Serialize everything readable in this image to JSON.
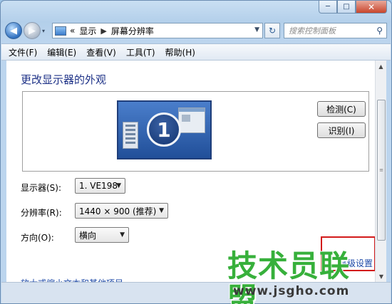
{
  "window": {
    "caption_minimize": "─",
    "caption_maximize": "□",
    "caption_close": "✕"
  },
  "nav": {
    "back_glyph": "◀",
    "forward_glyph": "▶",
    "history_glyph": "▾"
  },
  "address": {
    "chevron": "«",
    "crumb1": "显示",
    "separator": "▶",
    "crumb2": "屏幕分辨率",
    "dropdown_glyph": "▼",
    "icon": "control-panel-icon"
  },
  "refresh": {
    "glyph": "↻"
  },
  "search": {
    "placeholder": "搜索控制面板",
    "icon_glyph": "⚲"
  },
  "menu": [
    "文件(F)",
    "编辑(E)",
    "查看(V)",
    "工具(T)",
    "帮助(H)"
  ],
  "page": {
    "title": "更改显示器的外观",
    "monitor_number": "1"
  },
  "buttons": {
    "detect": "检测(C)",
    "identify": "识别(I)"
  },
  "form": {
    "display_label": "显示器(S):",
    "display_value": "1. VE198",
    "resolution_label": "分辨率(R):",
    "resolution_value": "1440 × 900 (推荐)",
    "orientation_label": "方向(O):",
    "orientation_value": "横向",
    "combo_arrow": "▼"
  },
  "links": {
    "advanced": "高级设置",
    "text_size_partial": "放大或缩小文本和其他项目"
  },
  "scrollbar": {
    "up": "▲",
    "down": "▼",
    "grip": "≡"
  },
  "watermark": {
    "brand": "技术员联盟",
    "url": "www.jsgho.com"
  },
  "colors": {
    "title_blue": "#1e3287",
    "link_blue": "#1e4aa8",
    "highlight_red": "#d21a1a",
    "watermark_green": "#37b03b"
  }
}
